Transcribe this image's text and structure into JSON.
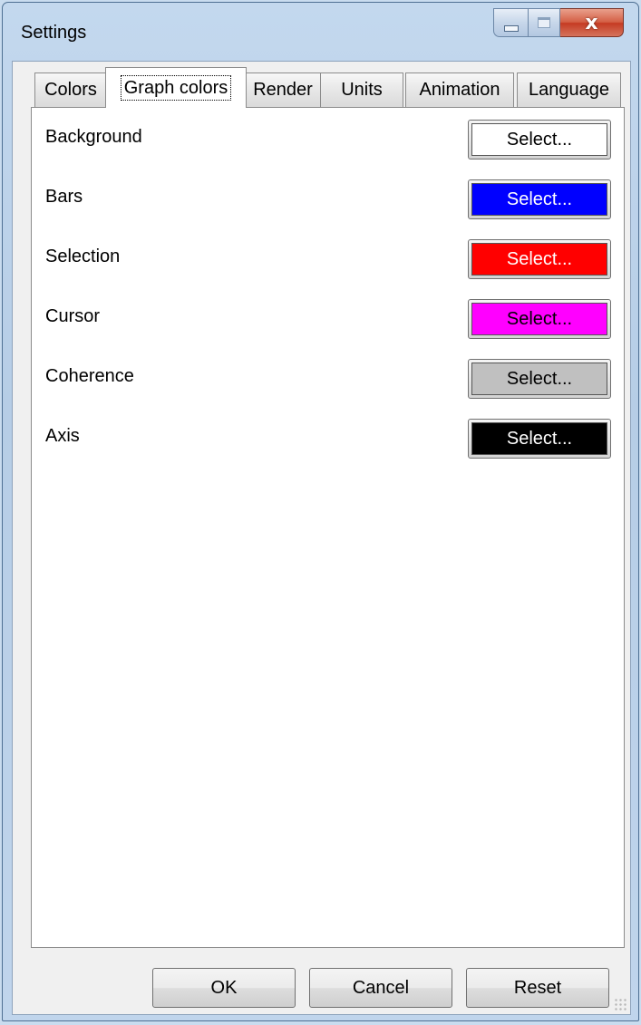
{
  "window": {
    "title": "Settings"
  },
  "caption": {
    "close_glyph": "x"
  },
  "tabs": [
    {
      "label": "Colors",
      "active": false
    },
    {
      "label": "Graph colors",
      "active": true
    },
    {
      "label": "Render",
      "active": false
    },
    {
      "label": "Units",
      "active": false
    },
    {
      "label": "Animation",
      "active": false
    },
    {
      "label": "Language",
      "active": false
    }
  ],
  "color_rows": [
    {
      "label": "Background",
      "button": "Select...",
      "swatch": "#ffffff",
      "text_color": "#000000"
    },
    {
      "label": "Bars",
      "button": "Select...",
      "swatch": "#0000ff",
      "text_color": "#ffffff"
    },
    {
      "label": "Selection",
      "button": "Select...",
      "swatch": "#ff0000",
      "text_color": "#ffffff"
    },
    {
      "label": "Cursor",
      "button": "Select...",
      "swatch": "#ff00ff",
      "text_color": "#000000"
    },
    {
      "label": "Coherence",
      "button": "Select...",
      "swatch": "#c0c0c0",
      "text_color": "#000000"
    },
    {
      "label": "Axis",
      "button": "Select...",
      "swatch": "#000000",
      "text_color": "#ffffff"
    }
  ],
  "footer": {
    "ok": "OK",
    "cancel": "Cancel",
    "reset": "Reset"
  }
}
